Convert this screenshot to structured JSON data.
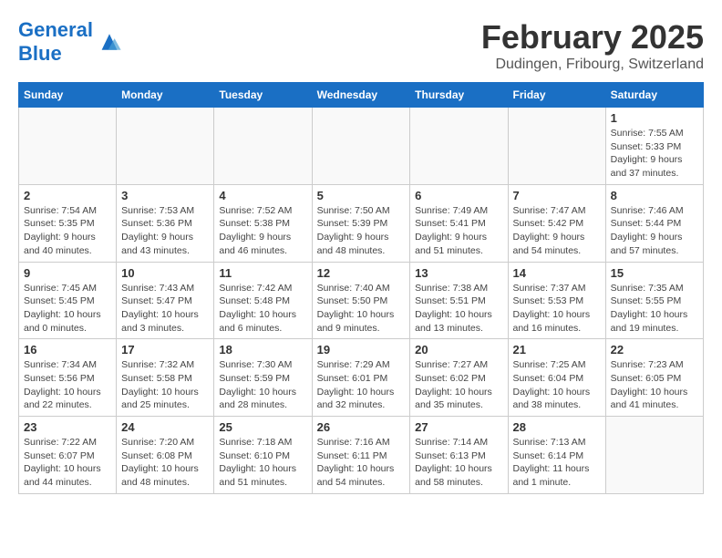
{
  "header": {
    "logo_text_normal": "General",
    "logo_text_blue": "Blue",
    "month": "February 2025",
    "location": "Dudingen, Fribourg, Switzerland"
  },
  "weekdays": [
    "Sunday",
    "Monday",
    "Tuesday",
    "Wednesday",
    "Thursday",
    "Friday",
    "Saturday"
  ],
  "weeks": [
    [
      {
        "day": "",
        "info": ""
      },
      {
        "day": "",
        "info": ""
      },
      {
        "day": "",
        "info": ""
      },
      {
        "day": "",
        "info": ""
      },
      {
        "day": "",
        "info": ""
      },
      {
        "day": "",
        "info": ""
      },
      {
        "day": "1",
        "info": "Sunrise: 7:55 AM\nSunset: 5:33 PM\nDaylight: 9 hours and 37 minutes."
      }
    ],
    [
      {
        "day": "2",
        "info": "Sunrise: 7:54 AM\nSunset: 5:35 PM\nDaylight: 9 hours and 40 minutes."
      },
      {
        "day": "3",
        "info": "Sunrise: 7:53 AM\nSunset: 5:36 PM\nDaylight: 9 hours and 43 minutes."
      },
      {
        "day": "4",
        "info": "Sunrise: 7:52 AM\nSunset: 5:38 PM\nDaylight: 9 hours and 46 minutes."
      },
      {
        "day": "5",
        "info": "Sunrise: 7:50 AM\nSunset: 5:39 PM\nDaylight: 9 hours and 48 minutes."
      },
      {
        "day": "6",
        "info": "Sunrise: 7:49 AM\nSunset: 5:41 PM\nDaylight: 9 hours and 51 minutes."
      },
      {
        "day": "7",
        "info": "Sunrise: 7:47 AM\nSunset: 5:42 PM\nDaylight: 9 hours and 54 minutes."
      },
      {
        "day": "8",
        "info": "Sunrise: 7:46 AM\nSunset: 5:44 PM\nDaylight: 9 hours and 57 minutes."
      }
    ],
    [
      {
        "day": "9",
        "info": "Sunrise: 7:45 AM\nSunset: 5:45 PM\nDaylight: 10 hours and 0 minutes."
      },
      {
        "day": "10",
        "info": "Sunrise: 7:43 AM\nSunset: 5:47 PM\nDaylight: 10 hours and 3 minutes."
      },
      {
        "day": "11",
        "info": "Sunrise: 7:42 AM\nSunset: 5:48 PM\nDaylight: 10 hours and 6 minutes."
      },
      {
        "day": "12",
        "info": "Sunrise: 7:40 AM\nSunset: 5:50 PM\nDaylight: 10 hours and 9 minutes."
      },
      {
        "day": "13",
        "info": "Sunrise: 7:38 AM\nSunset: 5:51 PM\nDaylight: 10 hours and 13 minutes."
      },
      {
        "day": "14",
        "info": "Sunrise: 7:37 AM\nSunset: 5:53 PM\nDaylight: 10 hours and 16 minutes."
      },
      {
        "day": "15",
        "info": "Sunrise: 7:35 AM\nSunset: 5:55 PM\nDaylight: 10 hours and 19 minutes."
      }
    ],
    [
      {
        "day": "16",
        "info": "Sunrise: 7:34 AM\nSunset: 5:56 PM\nDaylight: 10 hours and 22 minutes."
      },
      {
        "day": "17",
        "info": "Sunrise: 7:32 AM\nSunset: 5:58 PM\nDaylight: 10 hours and 25 minutes."
      },
      {
        "day": "18",
        "info": "Sunrise: 7:30 AM\nSunset: 5:59 PM\nDaylight: 10 hours and 28 minutes."
      },
      {
        "day": "19",
        "info": "Sunrise: 7:29 AM\nSunset: 6:01 PM\nDaylight: 10 hours and 32 minutes."
      },
      {
        "day": "20",
        "info": "Sunrise: 7:27 AM\nSunset: 6:02 PM\nDaylight: 10 hours and 35 minutes."
      },
      {
        "day": "21",
        "info": "Sunrise: 7:25 AM\nSunset: 6:04 PM\nDaylight: 10 hours and 38 minutes."
      },
      {
        "day": "22",
        "info": "Sunrise: 7:23 AM\nSunset: 6:05 PM\nDaylight: 10 hours and 41 minutes."
      }
    ],
    [
      {
        "day": "23",
        "info": "Sunrise: 7:22 AM\nSunset: 6:07 PM\nDaylight: 10 hours and 44 minutes."
      },
      {
        "day": "24",
        "info": "Sunrise: 7:20 AM\nSunset: 6:08 PM\nDaylight: 10 hours and 48 minutes."
      },
      {
        "day": "25",
        "info": "Sunrise: 7:18 AM\nSunset: 6:10 PM\nDaylight: 10 hours and 51 minutes."
      },
      {
        "day": "26",
        "info": "Sunrise: 7:16 AM\nSunset: 6:11 PM\nDaylight: 10 hours and 54 minutes."
      },
      {
        "day": "27",
        "info": "Sunrise: 7:14 AM\nSunset: 6:13 PM\nDaylight: 10 hours and 58 minutes."
      },
      {
        "day": "28",
        "info": "Sunrise: 7:13 AM\nSunset: 6:14 PM\nDaylight: 11 hours and 1 minute."
      },
      {
        "day": "",
        "info": ""
      }
    ]
  ]
}
